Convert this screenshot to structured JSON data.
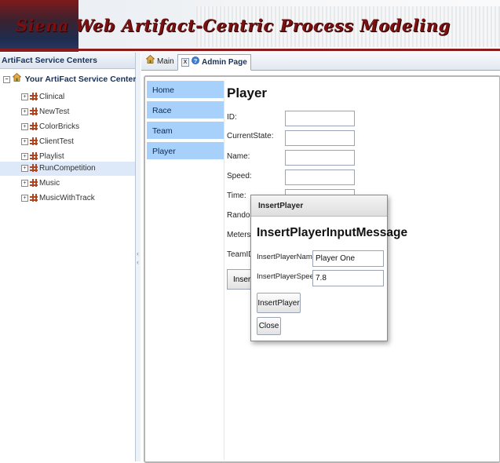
{
  "banner": {
    "title": "Siena Web  Artifact-Centric Process Modeling"
  },
  "left_panel": {
    "header": "ArtiFact Service Centers",
    "root_label": "Your ArtiFact Service Centers",
    "items": [
      {
        "label": "Clinical"
      },
      {
        "label": "NewTest"
      },
      {
        "label": "ColorBricks"
      },
      {
        "label": "ClientTest"
      },
      {
        "label": "Playlist"
      },
      {
        "label": "RunCompetition",
        "selected": true
      },
      {
        "label": "Music"
      },
      {
        "label": "MusicWithTrack"
      }
    ]
  },
  "tabs": [
    {
      "label": "Main",
      "icon": "home-icon"
    },
    {
      "label": "Admin Page",
      "icon": "help-icon",
      "active": true
    }
  ],
  "nav": {
    "items": [
      "Home",
      "Race",
      "Team",
      "Player"
    ]
  },
  "player_form": {
    "heading": "Player",
    "fields": [
      "ID:",
      "CurrentState:",
      "Name:",
      "Speed:",
      "Time:",
      "Randoml",
      "MetersLe",
      "TeamID:"
    ],
    "button_visible_text": "InsertF"
  },
  "dialog": {
    "title": "InsertPlayer",
    "heading": "InsertPlayerInputMessage",
    "name_label": "InsertPlayerName:",
    "name_value": "Player One",
    "speed_label": "InsertPlayerSpeed:",
    "speed_value": "7.8",
    "insert_button": "InsertPlayer",
    "close_button": "Close"
  }
}
